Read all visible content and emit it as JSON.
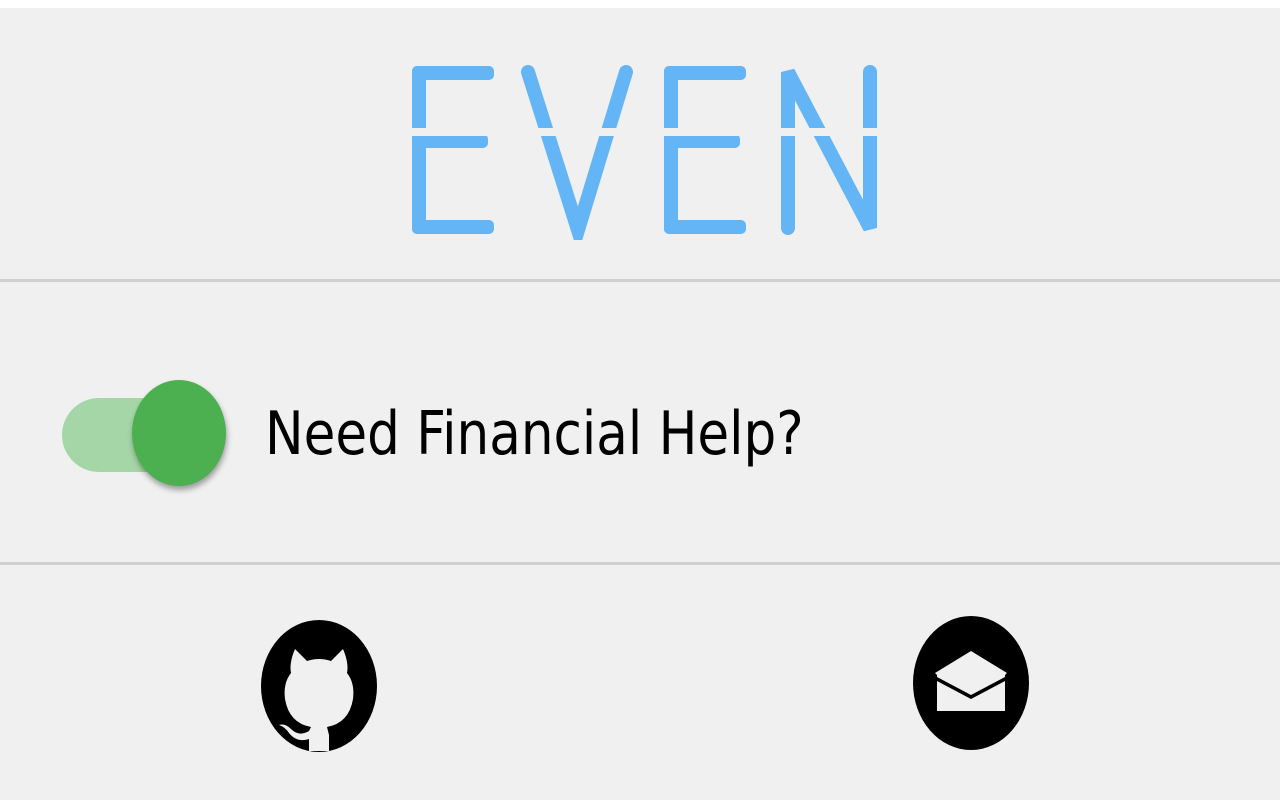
{
  "logo": {
    "text": "EVEN",
    "color": "#64b5f6"
  },
  "settings": {
    "toggle_label": "Need Financial Help?",
    "toggle_on": true,
    "toggle_track_color": "#a5d6a7",
    "toggle_knob_color": "#4caf50"
  },
  "footer": {
    "github_icon": "github-icon",
    "email_icon": "email-icon"
  }
}
